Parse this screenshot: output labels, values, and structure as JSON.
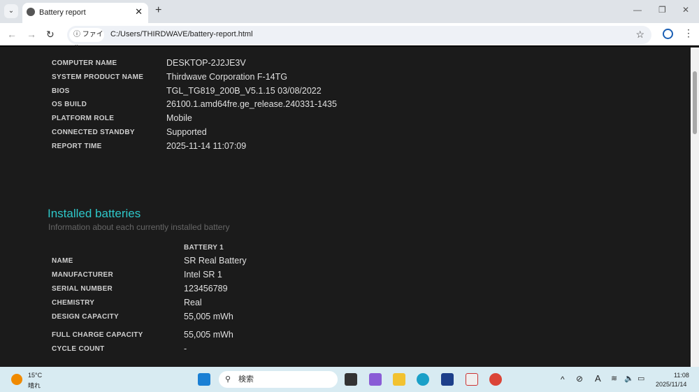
{
  "browser": {
    "tab_title": "Battery report",
    "address_chip": "ファイル",
    "url": "C:/Users/THIRDWAVE/battery-report.html"
  },
  "system_info": [
    {
      "label": "COMPUTER NAME",
      "value": "DESKTOP-2J2JE3V"
    },
    {
      "label": "SYSTEM PRODUCT NAME",
      "value": "Thirdwave Corporation F-14TG"
    },
    {
      "label": "BIOS",
      "value": "TGL_TG819_200B_V5.1.15 03/08/2022"
    },
    {
      "label": "OS BUILD",
      "value": "26100.1.amd64fre.ge_release.240331-1435"
    },
    {
      "label": "PLATFORM ROLE",
      "value": "Mobile"
    },
    {
      "label": "CONNECTED STANDBY",
      "value": "Supported"
    },
    {
      "label": "REPORT TIME",
      "value": "2025-11-14  11:07:09"
    }
  ],
  "installed": {
    "title": "Installed batteries",
    "subtitle": "Information about each currently installed battery",
    "column": "BATTERY 1",
    "rows": [
      {
        "label": "NAME",
        "value": "SR Real Battery"
      },
      {
        "label": "MANUFACTURER",
        "value": "Intel SR 1"
      },
      {
        "label": "SERIAL NUMBER",
        "value": "123456789"
      },
      {
        "label": "CHEMISTRY",
        "value": "Real"
      },
      {
        "label": "DESIGN CAPACITY",
        "value": "55,005 mWh"
      },
      {
        "label": "FULL CHARGE CAPACITY",
        "value": "55,005 mWh"
      },
      {
        "label": "CYCLE COUNT",
        "value": "-"
      }
    ]
  },
  "taskbar": {
    "temp": "15°C",
    "weather": "晴れ",
    "search": "検索",
    "time": "11:08",
    "date": "2025/11/14"
  }
}
